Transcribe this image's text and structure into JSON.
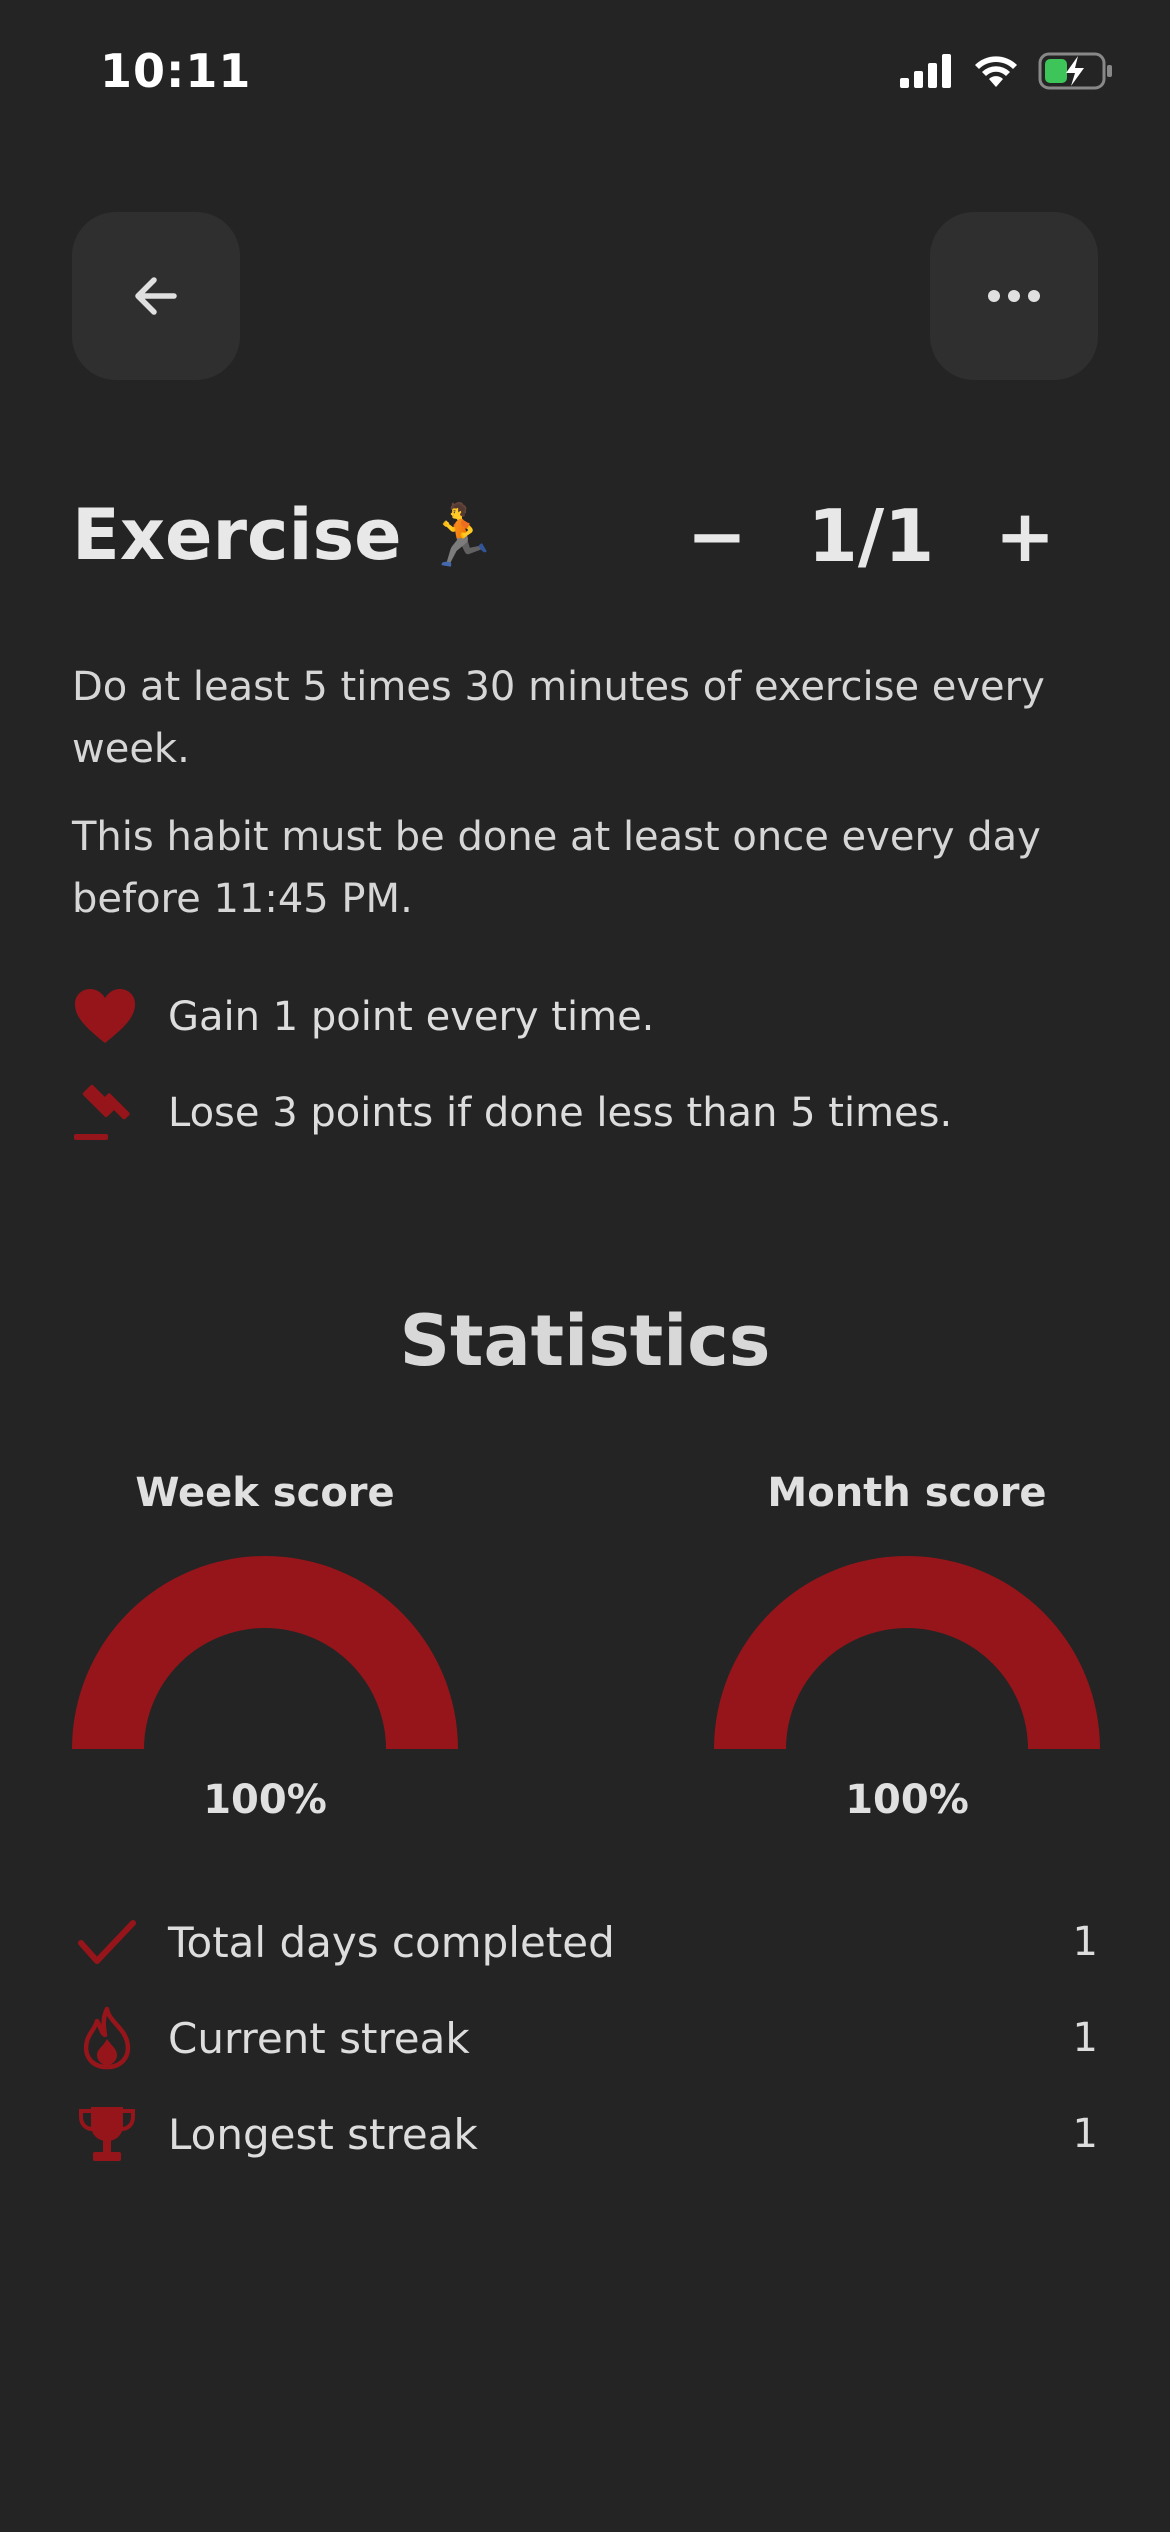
{
  "status_bar": {
    "time": "10:11"
  },
  "header": {
    "back_icon": "arrow-left-icon",
    "more_icon": "more-horizontal-icon"
  },
  "habit": {
    "title": "Exercise",
    "emoji": "🏃",
    "counter": {
      "minus": "−",
      "value": "1/1",
      "plus": "+"
    },
    "description": "Do at least 5 times 30 minutes of exercise every week.",
    "schedule": "This habit must be done at least once every day before 11:45 PM.",
    "rules": [
      {
        "icon": "heart-icon",
        "text": "Gain 1 point every time."
      },
      {
        "icon": "gavel-icon",
        "text": "Lose 3 points if done less than 5 times."
      }
    ]
  },
  "statistics": {
    "title": "Statistics",
    "week": {
      "label": "Week score",
      "percent_text": "100%",
      "value": 100
    },
    "month": {
      "label": "Month score",
      "percent_text": "100%",
      "value": 100
    },
    "rows": [
      {
        "icon": "check-icon",
        "label": "Total days completed",
        "value": "1"
      },
      {
        "icon": "flame-icon",
        "label": "Current streak",
        "value": "1"
      },
      {
        "icon": "trophy-icon",
        "label": "Longest streak",
        "value": "1"
      }
    ]
  },
  "colors": {
    "background": "#242424",
    "accent": "#96151a",
    "button": "#2f2f2f"
  }
}
